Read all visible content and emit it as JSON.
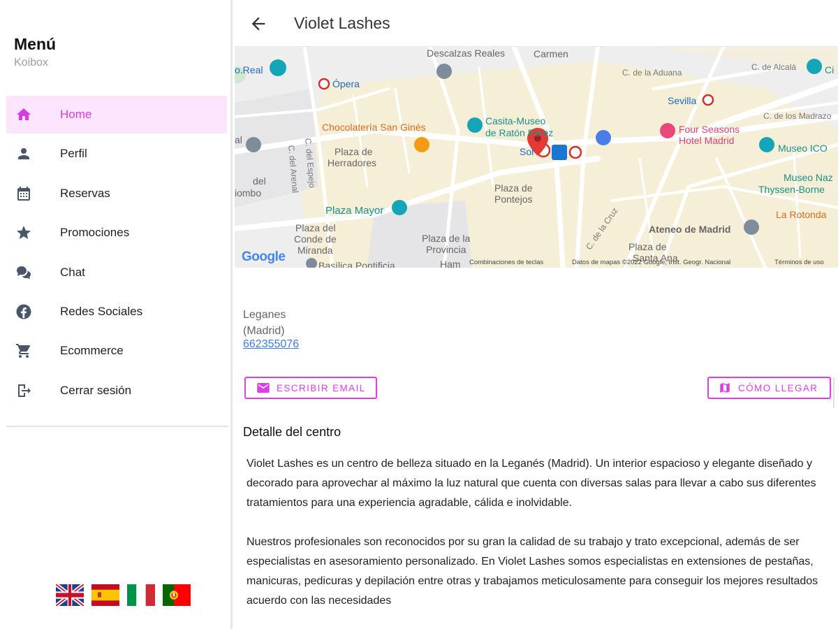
{
  "sidebar": {
    "title": "Menú",
    "subtitle": "Koibox",
    "items": [
      {
        "label": "Home",
        "icon": "home-icon",
        "active": true
      },
      {
        "label": "Perfil",
        "icon": "person-icon"
      },
      {
        "label": "Reservas",
        "icon": "calendar-icon"
      },
      {
        "label": "Promociones",
        "icon": "star-icon"
      },
      {
        "label": "Chat",
        "icon": "chat-icon"
      },
      {
        "label": "Redes Sociales",
        "icon": "facebook-icon"
      },
      {
        "label": "Ecommerce",
        "icon": "cart-icon"
      },
      {
        "label": "Cerrar sesión",
        "icon": "logout-icon"
      }
    ],
    "languages": [
      "uk-flag-icon",
      "spain-flag-icon",
      "italy-flag-icon",
      "portugal-flag-icon"
    ]
  },
  "header": {
    "title": "Violet Lashes"
  },
  "map": {
    "labels": {
      "descalzas": "Descalzas Reales",
      "carmen": "Carmen",
      "real": "o.Real",
      "opera": "Ópera",
      "aduana": "C. de la Aduana",
      "alcala": "C. de Alcalá",
      "sevilla": "Sevilla",
      "madrazo": "C. de los Madrazo",
      "chocolateria": "Chocolatería San Ginés",
      "casita1": "Casita-Museo",
      "casita2": "de Ratón Pérez",
      "sol": "Sol",
      "fourseasons1": "Four Seasons",
      "fourseasons2": "Hotel Madrid",
      "museoico": "Museo ICO",
      "ci": "Ci",
      "al": "al",
      "herradores1": "Plaza de",
      "herradores2": "Herradores",
      "arenal": "C. del Arenal",
      "elpaso": "C. del Espejo",
      "del": "del",
      "iombo": "iombo",
      "pontejos1": "Plaza de",
      "pontejos2": "Pontejos",
      "museonaz": "Museo Naz",
      "thyssen": "Thyssen-Borne",
      "mayor": "Plaza Mayor",
      "rotonda": "La Rotonda",
      "cruz": "C. de la Cruz",
      "ateneo": "Ateneo de Madrid",
      "conde1": "Plaza del",
      "conde2": "Conde de",
      "conde3": "Miranda",
      "provincia1": "Plaza de la",
      "provincia2": "Provincia",
      "santaana": "Plaza de",
      "santaana2": "Santa Ana",
      "basilica": "Basílica Pontificia",
      "ham": "Ham",
      "google": "Google",
      "shortcuts": "Combinaciones de teclas",
      "mapdata": "Datos de mapas ©2022 Google, Inst. Geogr. Nacional",
      "terms": "Términos de uso"
    }
  },
  "info": {
    "address_line1": "Leganes",
    "address_line2": "(Madrid)",
    "phone": "662355076",
    "email_button": "ESCRIBIR EMAIL",
    "route_button": "CÓMO LLEGAR"
  },
  "detail": {
    "title": "Detalle del centro",
    "paragraph1": "Violet Lashes es un centro de belleza situado en la Leganés (Madrid). Un interior espacioso y elegante diseñado y decorado para aprovechar al máximo la luz natural que cuenta con diversas salas para llevar a cabo sus diferentes tratamientos para una experiencia agradable, cálida e inolvidable.",
    "paragraph2": "Nuestros profesionales son reconocidos por su gran la calidad de su trabajo y trato excepcional, además de ser especialistas en asesoramiento personalizado. En Violet Lashes somos especialistas en extensiones de pestañas, manicuras, pedicuras y depilación entre otras y trabajamos meticulosamente para conseguir los mejores resultados acuerdo con las necesidades"
  },
  "colors": {
    "accent": "#dd3fe6",
    "active_bg": "#fce5ff",
    "link": "#3a7de0"
  }
}
